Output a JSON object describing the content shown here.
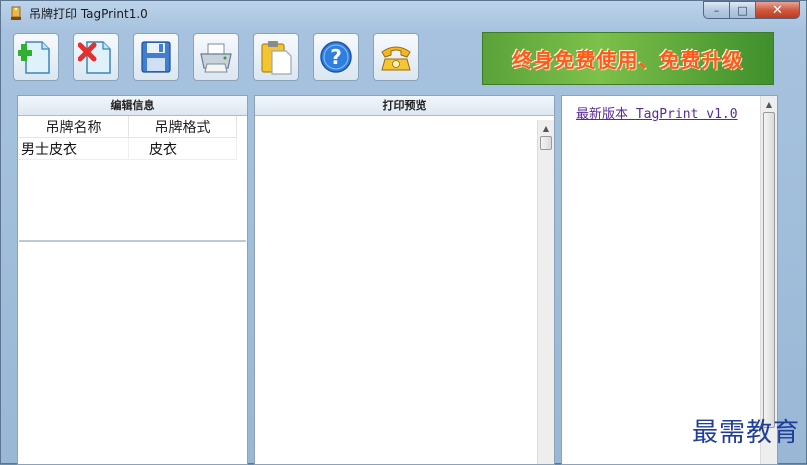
{
  "window": {
    "title": "吊牌打印 TagPrint1.0",
    "controls": {
      "minimize": "–",
      "maximize": "□",
      "close": "✕"
    }
  },
  "toolbar": {
    "buttons": [
      {
        "id": "add",
        "icon": "add-document-icon"
      },
      {
        "id": "delete",
        "icon": "delete-document-icon"
      },
      {
        "id": "save",
        "icon": "floppy-disk-icon"
      },
      {
        "id": "print",
        "icon": "printer-icon"
      },
      {
        "id": "paste",
        "icon": "clipboard-icon"
      },
      {
        "id": "help",
        "icon": "help-icon"
      },
      {
        "id": "contact",
        "icon": "telephone-icon"
      }
    ],
    "banner_text": "终身免费使用、免费升级",
    "colors": {
      "banner_green": "#5aa23a",
      "banner_text": "#ff5a1a"
    }
  },
  "edit_panel": {
    "header": "编辑信息",
    "columns": [
      "吊牌名称",
      "吊牌格式"
    ],
    "rows": [
      [
        "男士皮衣",
        "皮衣"
      ]
    ]
  },
  "preview_panel": {
    "header": "打印预览"
  },
  "right_panel": {
    "link": "最新版本 TagPrint v1.0"
  },
  "watermark": "最需教育"
}
